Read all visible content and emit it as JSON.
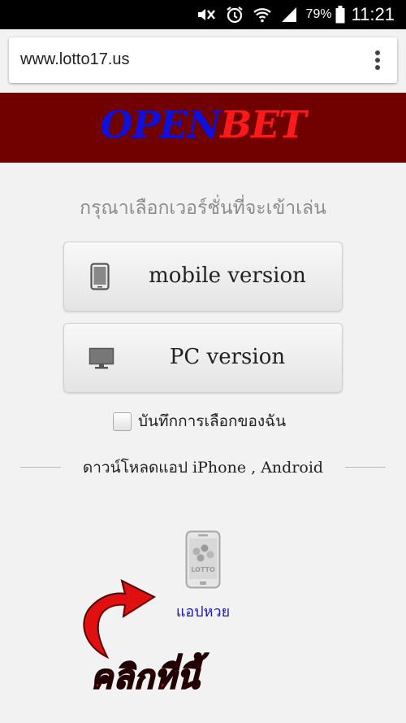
{
  "status_bar": {
    "battery_percent": "79%",
    "time": "11:21",
    "icons": [
      "mute-icon",
      "alarm-icon",
      "wifi-icon",
      "signal-icon",
      "battery-icon"
    ]
  },
  "browser": {
    "url": "www.lotto17.us",
    "menu_icon": "more-vert-icon"
  },
  "banner": {
    "logo_part1": "OPEN",
    "logo_part2": "BET",
    "colors": {
      "background": "#710000",
      "open": "#1010d8",
      "bet": "#ff1a1a"
    }
  },
  "main": {
    "prompt": "กรุณาเลือกเวอร์ชั่นที่จะเข้าเล่น",
    "mobile_button": {
      "label": "mobile version",
      "icon": "tablet-icon"
    },
    "pc_button": {
      "label": "PC version",
      "icon": "monitor-icon"
    },
    "remember_label": "บันทึกการเลือกของฉัน",
    "remember_checked": false,
    "download_text": "ดาวน์โหลดแอป iPhone , Android",
    "app": {
      "icon_text": "LOTTO",
      "label": "แอปหวย"
    },
    "click_here": "คลิกที่นี้"
  }
}
